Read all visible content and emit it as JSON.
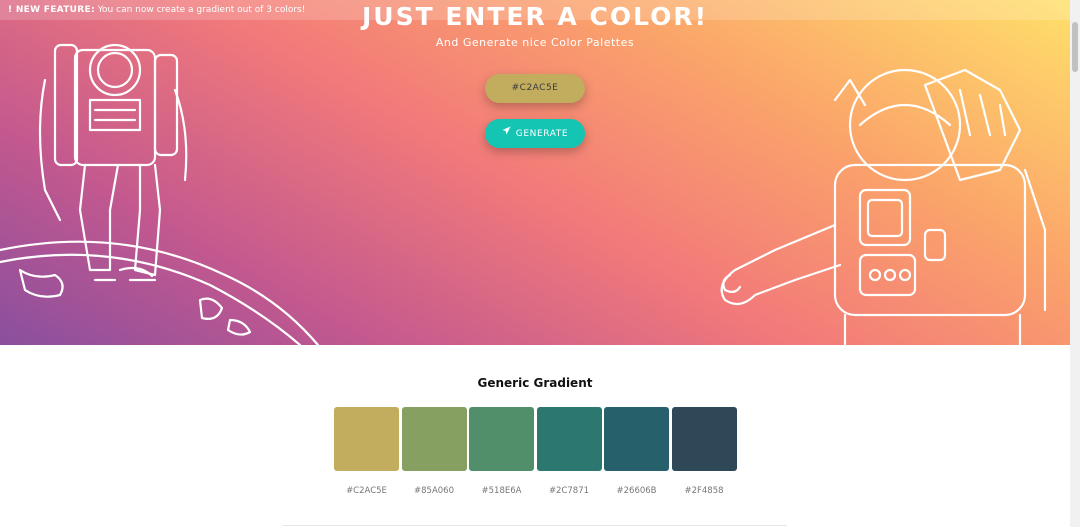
{
  "banner": {
    "label": "! NEW FEATURE:",
    "text": "You can now create a gradient out of 3 colors!"
  },
  "hero": {
    "title": "JUST ENTER A COLOR!",
    "subtitle": "And Generate nice Color Palettes",
    "input_value": "#C2AC5E",
    "generate_label": "GENERATE"
  },
  "palette": {
    "title": "Generic Gradient",
    "swatches": [
      {
        "hex": "#C2AC5E",
        "color": "#c2ac5e"
      },
      {
        "hex": "#85A060",
        "color": "#85a060"
      },
      {
        "hex": "#518E6A",
        "color": "#518e6a"
      },
      {
        "hex": "#2C7871",
        "color": "#2c7871"
      },
      {
        "hex": "#26606B",
        "color": "#26606b"
      },
      {
        "hex": "#2F4858",
        "color": "#2f4858"
      }
    ]
  },
  "icons": {
    "generate": "paper-plane-icon"
  }
}
